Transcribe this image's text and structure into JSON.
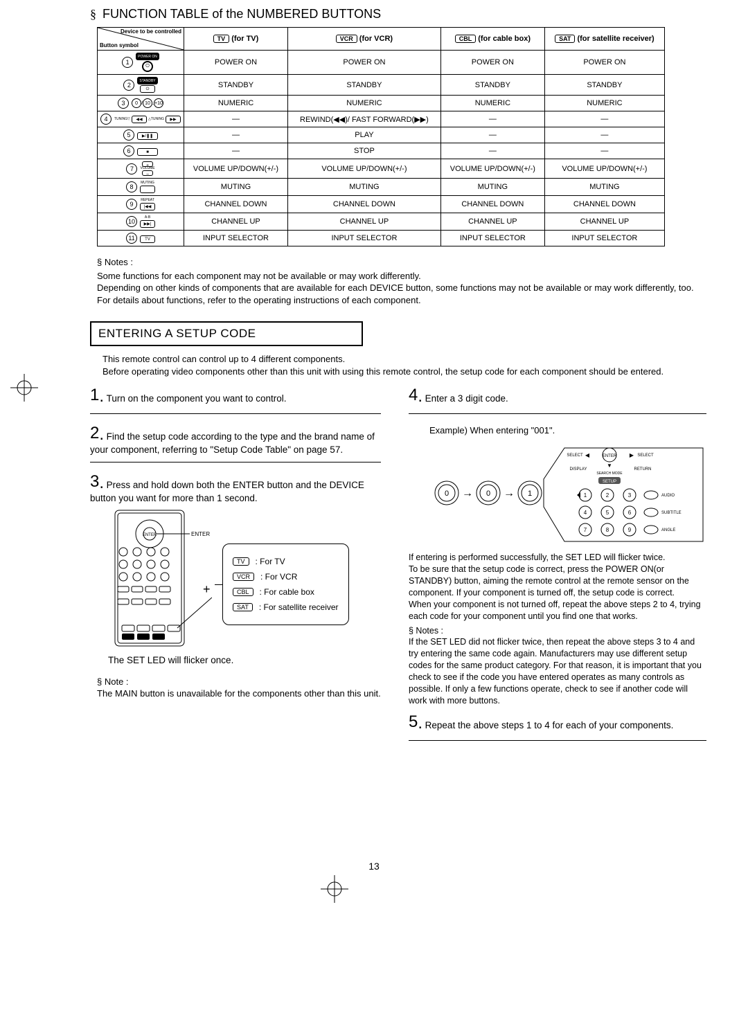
{
  "page_number": "13",
  "section1": {
    "bullet": "§",
    "title": "FUNCTION TABLE of the NUMBERED BUTTONS",
    "header_corner_top": "Device to be controlled",
    "header_corner_bottom": "Button symbol",
    "devices": [
      {
        "code": "TV",
        "label": "(for TV)"
      },
      {
        "code": "VCR",
        "label": "(for VCR)"
      },
      {
        "code": "CBL",
        "label": "(for cable box)"
      },
      {
        "code": "SAT",
        "label": "(for satellite receiver)"
      }
    ],
    "rows": [
      {
        "n": "1",
        "sym_text": "POWER ON",
        "sym_style": "dark-pill-round",
        "cells": [
          "POWER ON",
          "POWER ON",
          "POWER ON",
          "POWER ON"
        ]
      },
      {
        "n": "2",
        "sym_text": "STANDBY",
        "sym_style": "pill-standby",
        "cells": [
          "STANDBY",
          "STANDBY",
          "STANDBY",
          "STANDBY"
        ]
      },
      {
        "n": "3",
        "sym_text": "",
        "sym_style": "three-round",
        "cells": [
          "NUMERIC",
          "NUMERIC",
          "NUMERIC",
          "NUMERIC"
        ]
      },
      {
        "n": "4",
        "sym_text": "TUNING",
        "sym_style": "rew-ff",
        "cells": [
          "—",
          "REWIND(◀◀)/ FAST FORWARD(▶▶)",
          "—",
          "—"
        ]
      },
      {
        "n": "5",
        "sym_text": "",
        "sym_style": "play-pill",
        "cells": [
          "—",
          "PLAY",
          "—",
          "—"
        ]
      },
      {
        "n": "6",
        "sym_text": "",
        "sym_style": "stop-pill",
        "cells": [
          "—",
          "STOP",
          "—",
          "—"
        ]
      },
      {
        "n": "7",
        "sym_text": "VOLUME",
        "sym_style": "vol-rocker",
        "cells": [
          "VOLUME UP/DOWN(+/-)",
          "VOLUME UP/DOWN(+/-)",
          "VOLUME UP/DOWN(+/-)",
          "VOLUME UP/DOWN(+/-)"
        ]
      },
      {
        "n": "8",
        "sym_text": "MUTING",
        "sym_style": "mute-pill",
        "cells": [
          "MUTING",
          "MUTING",
          "MUTING",
          "MUTING"
        ]
      },
      {
        "n": "9",
        "sym_text": "REPEAT",
        "sym_style": "repeat-pill",
        "cells": [
          "CHANNEL DOWN",
          "CHANNEL DOWN",
          "CHANNEL DOWN",
          "CHANNEL DOWN"
        ]
      },
      {
        "n": "10",
        "sym_text": "A-B",
        "sym_style": "ab-pill",
        "cells": [
          "CHANNEL UP",
          "CHANNEL UP",
          "CHANNEL UP",
          "CHANNEL UP"
        ]
      },
      {
        "n": "11",
        "sym_text": "TV",
        "sym_style": "tv-pill",
        "cells": [
          "INPUT SELECTOR",
          "INPUT SELECTOR",
          "INPUT SELECTOR",
          "INPUT SELECTOR"
        ]
      }
    ],
    "notes_heading": "§ Notes :",
    "notes_lines": [
      "Some functions for each component may not be available or may work differently.",
      "Depending on other kinds of components that are available for each DEVICE button, some functions may not be available or may work differently, too.",
      "For details about functions, refer to the operating instructions of each component."
    ]
  },
  "section2": {
    "title": "ENTERING A SETUP CODE",
    "intro": [
      "This remote control can control up to 4 different components.",
      "Before operating video components other than this unit with using this remote control, the setup code for each component should be entered."
    ],
    "steps_left": [
      {
        "n": "1",
        "text": "Turn on the component you want to control."
      },
      {
        "n": "2",
        "text": "Find the setup code according to the type and the brand name of your component, referring to \"Setup Code Table\" on page 57."
      },
      {
        "n": "3",
        "text": "Press and hold down both the ENTER button and the DEVICE button you want for more than 1 second."
      }
    ],
    "remote_labels": {
      "enter": "ENTER",
      "select": "SELECT",
      "plus": "+",
      "tv": {
        "code": "TV",
        "desc": ": For TV"
      },
      "vcr": {
        "code": "VCR",
        "desc": ": For VCR"
      },
      "cbl": {
        "code": "CBL",
        "desc": ": For cable box"
      },
      "sat": {
        "code": "SAT",
        "desc": ": For satellite receiver"
      }
    },
    "after_step3_line": "The SET LED will flicker once.",
    "note3_heading": "§ Note :",
    "note3_body": "The MAIN button is unavailable for the components other than this unit.",
    "steps_right": [
      {
        "n": "4",
        "text": "Enter a 3 digit code."
      }
    ],
    "example_label": "Example) When entering \"001\".",
    "keypad_labels": {
      "select_l": "SELECT",
      "select_r": "SELECT",
      "enter": "ENTER",
      "display": "DISPLAY",
      "return": "RETURN",
      "search_mode": "SEARCH MODE",
      "setup": "SETUP",
      "audio": "AUDIO",
      "subtitle": "SUBTITLE",
      "angle": "ANGLE",
      "digits": [
        "1",
        "2",
        "3",
        "4",
        "5",
        "6",
        "7",
        "8",
        "9"
      ],
      "seq": [
        "0",
        "0",
        "1"
      ]
    },
    "result_lines": [
      "If entering is performed successfully, the SET LED will flicker twice.",
      "To be sure that the setup code is correct, press the POWER ON(or STANDBY) button, aiming the remote control at the remote sensor on the component. If your component is turned off, the setup code is correct.",
      "When your component is not turned off, repeat the above steps 2 to 4, trying each code for your component until you find one that works."
    ],
    "notes2_heading": "§ Notes :",
    "notes2_body": "If the SET LED did not flicker twice, then repeat the above steps 3 to 4 and try entering the same code again. Manufacturers may use different setup codes for the same product category. For that reason, it is important that you check to see if the code you have entered operates as many controls as possible. If only a few functions operate, check to see if another code will work with more buttons.",
    "step5": {
      "n": "5",
      "text": "Repeat the above steps 1 to 4 for each of your components."
    }
  }
}
